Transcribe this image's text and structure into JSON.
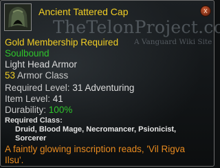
{
  "tooltip": {
    "title": "Ancient Tattered Cap",
    "close_label": "x",
    "watermark": {
      "main": "TheTelonProject.com",
      "sub": "A Vanguard Wiki Site"
    },
    "requirement": "Gold Membership Required",
    "binding": "Soulbound",
    "item_type": "Light Head Armor",
    "armor": {
      "value": "53",
      "label": "Armor Class"
    },
    "required_level": {
      "label": "Required Level:",
      "value": "31 Adventuring"
    },
    "item_level": {
      "label": "Item Level:",
      "value": "41"
    },
    "durability": {
      "label": "Durability:",
      "value": "100%"
    },
    "required_class_label": "Required Class:",
    "classes_line1": "Druid, Blood Mage, Necromancer, Psionicist,",
    "classes_line2": "Sorcerer",
    "description_line1": "A faintly glowing inscription reads, 'Vil Rigva",
    "description_line2": "Ilsu'."
  },
  "colors": {
    "gold": "#f2cf25",
    "green": "#2fc52b",
    "orange": "#e88a1f",
    "stat_gray": "#c9c9c9"
  },
  "icons": {
    "item": "hood-helmet-icon",
    "close": "close-icon"
  }
}
